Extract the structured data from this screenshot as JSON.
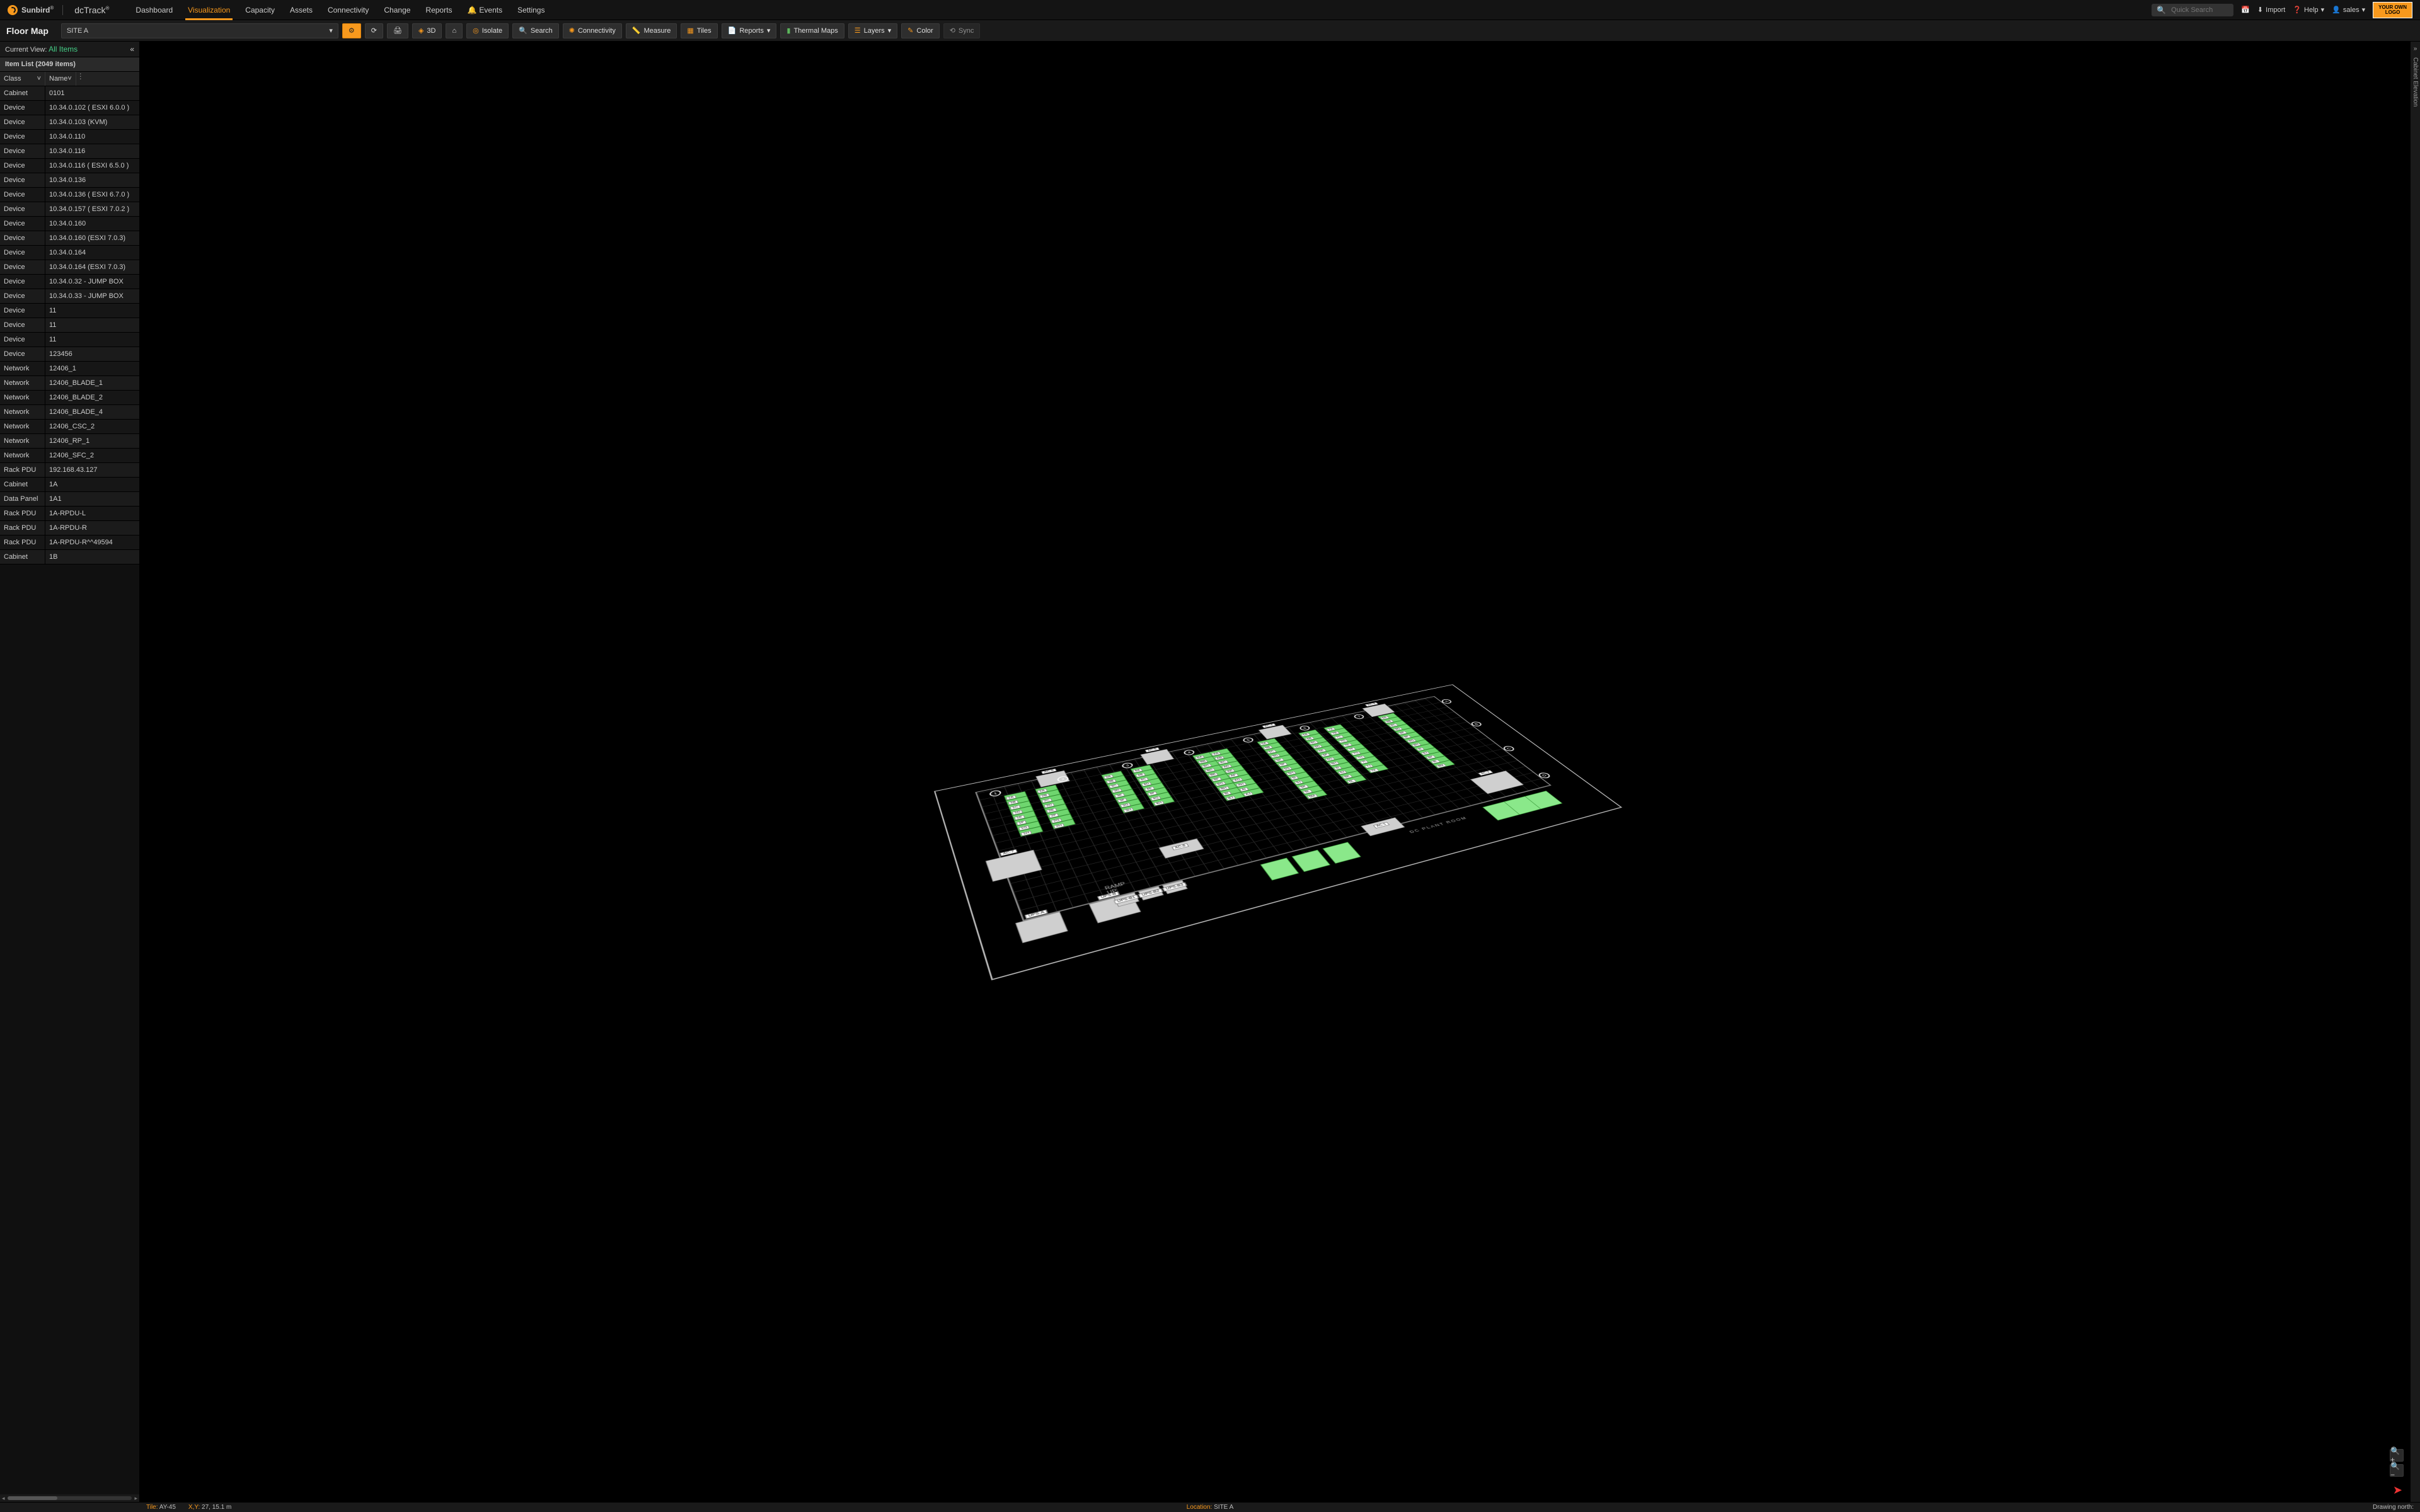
{
  "brand": {
    "sunbird": "Sunbird",
    "reg": "®",
    "app": "dcTrack",
    "reg2": "®"
  },
  "nav": {
    "items": [
      "Dashboard",
      "Visualization",
      "Capacity",
      "Assets",
      "Connectivity",
      "Change",
      "Reports",
      "Events",
      "Settings"
    ],
    "active": "Visualization",
    "events_label": "Events"
  },
  "search": {
    "placeholder": "Quick Search"
  },
  "tools": {
    "import": "Import",
    "help": "Help",
    "user": "sales",
    "logo_line1": "YOUR OWN",
    "logo_line2": "LOGO"
  },
  "subnav": {
    "title": "Floor Map",
    "site": "SITE A",
    "btn_3d": "3D",
    "btn_isolate": "Isolate",
    "btn_search": "Search",
    "btn_connectivity": "Connectivity",
    "btn_measure": "Measure",
    "btn_tiles": "Tiles",
    "btn_reports": "Reports",
    "btn_thermal": "Thermal Maps",
    "btn_layers": "Layers",
    "btn_color": "Color",
    "btn_sync": "Sync"
  },
  "side": {
    "current_view_label": "Current View:",
    "current_view_value": "All Items",
    "list_title": "Item List (2049 items)",
    "col_class": "Class",
    "col_name": "Name",
    "rows": [
      {
        "class": "Cabinet",
        "name": "0101"
      },
      {
        "class": "Device",
        "name": "10.34.0.102 ( ESXI 6.0.0 )"
      },
      {
        "class": "Device",
        "name": "10.34.0.103 (KVM)"
      },
      {
        "class": "Device",
        "name": "10.34.0.110"
      },
      {
        "class": "Device",
        "name": "10.34.0.116"
      },
      {
        "class": "Device",
        "name": "10.34.0.116 ( ESXI 6.5.0 )"
      },
      {
        "class": "Device",
        "name": "10.34.0.136"
      },
      {
        "class": "Device",
        "name": "10.34.0.136 ( ESXI 6.7.0 )"
      },
      {
        "class": "Device",
        "name": "10.34.0.157 ( ESXI 7.0.2 )"
      },
      {
        "class": "Device",
        "name": "10.34.0.160"
      },
      {
        "class": "Device",
        "name": "10.34.0.160 (ESXI 7.0.3)"
      },
      {
        "class": "Device",
        "name": "10.34.0.164"
      },
      {
        "class": "Device",
        "name": "10.34.0.164 (ESXI 7.0.3)"
      },
      {
        "class": "Device",
        "name": "10.34.0.32 - JUMP BOX"
      },
      {
        "class": "Device",
        "name": "10.34.0.33 - JUMP BOX"
      },
      {
        "class": "Device",
        "name": "11"
      },
      {
        "class": "Device",
        "name": "11"
      },
      {
        "class": "Device",
        "name": "11"
      },
      {
        "class": "Device",
        "name": "123456"
      },
      {
        "class": "Network",
        "name": "12406_1"
      },
      {
        "class": "Network",
        "name": "12406_BLADE_1"
      },
      {
        "class": "Network",
        "name": "12406_BLADE_2"
      },
      {
        "class": "Network",
        "name": "12406_BLADE_4"
      },
      {
        "class": "Network",
        "name": "12406_CSC_2"
      },
      {
        "class": "Network",
        "name": "12406_RP_1"
      },
      {
        "class": "Network",
        "name": "12406_SFC_2"
      },
      {
        "class": "Rack PDU",
        "name": "192.168.43.127"
      },
      {
        "class": "Cabinet",
        "name": "1A"
      },
      {
        "class": "Data Panel",
        "name": "1A1"
      },
      {
        "class": "Rack PDU",
        "name": "1A-RPDU-L"
      },
      {
        "class": "Rack PDU",
        "name": "1A-RPDU-R"
      },
      {
        "class": "Rack PDU",
        "name": "1A-RPDU-R^^49594"
      },
      {
        "class": "Cabinet",
        "name": "1B"
      }
    ]
  },
  "right_rail": {
    "label": "Cabinet Elevation"
  },
  "status": {
    "tile_k": "Tile:",
    "tile_v": "AY-45",
    "xy_k": "X,Y:",
    "xy_v": "27, 15.1 m",
    "loc_k": "Location:",
    "loc_v": "SITE A",
    "north": "Drawing north:"
  },
  "floor": {
    "ac_units": [
      "AC-6",
      "AC-5",
      "AC-4",
      "AC-3"
    ],
    "ac_side": [
      "AC-7",
      "AC-8",
      "AC-1",
      "AC-2"
    ],
    "ups": [
      "UPS-A",
      "UPS-B",
      "UPS-B1",
      "UPS-B2",
      "UPS-B3"
    ],
    "ramp": "RAMP\nUP",
    "plant": "DC PLANT ROOM",
    "edge_markers": [
      "A",
      "B",
      "C",
      "D"
    ],
    "row_markers": [
      "1",
      "2",
      "3",
      "4",
      "5",
      "6",
      "7"
    ],
    "rows": [
      {
        "prefix": "1",
        "tags": [
          "1A",
          "1B",
          "1C",
          "1D",
          "1E",
          "1F",
          "1G",
          "1H"
        ]
      },
      {
        "prefix": "2",
        "tags": [
          "2A",
          "2B",
          "2C",
          "2D",
          "2E",
          "2F",
          "2G",
          "2H"
        ]
      },
      {
        "prefix": "3",
        "tags": [
          "3A",
          "3B",
          "3C",
          "3D",
          "3E",
          "3F",
          "3G",
          "3H"
        ]
      },
      {
        "prefix": "4",
        "tags": [
          "4A",
          "4B",
          "4C",
          "4D",
          "4E",
          "4F",
          "4G",
          "4H"
        ]
      },
      {
        "prefix": "B",
        "tags": [
          "BA",
          "BB",
          "BC",
          "BD",
          "BE",
          "BF",
          "BG",
          "BH",
          "BI",
          "BJ"
        ]
      },
      {
        "prefix": "A",
        "tags": [
          "AA",
          "AB",
          "AC",
          "AD",
          "AE",
          "AF",
          "AG",
          "AH",
          "AI",
          "AJ"
        ]
      },
      {
        "prefix": "5",
        "tags": [
          "5A",
          "5B",
          "5C",
          "5D",
          "5E",
          "5F",
          "5G",
          "5H",
          "5I",
          "5J",
          "5K",
          "5L",
          "5M"
        ]
      },
      {
        "prefix": "6",
        "tags": [
          "6A",
          "6B",
          "6C",
          "6D",
          "6E",
          "6F",
          "6G",
          "6H",
          "6I",
          "6J",
          "6K",
          "6L"
        ]
      },
      {
        "prefix": "7",
        "tags": [
          "7A",
          "7B",
          "7C",
          "7D",
          "7E",
          "7F",
          "7G",
          "7H",
          "7I",
          "7J",
          "7K"
        ]
      },
      {
        "prefix": "8",
        "tags": [
          "8A",
          "8B",
          "8C",
          "8D",
          "8E",
          "8F",
          "8G",
          "8H",
          "8I",
          "8J",
          "8K",
          "8L",
          "8M"
        ]
      }
    ]
  }
}
